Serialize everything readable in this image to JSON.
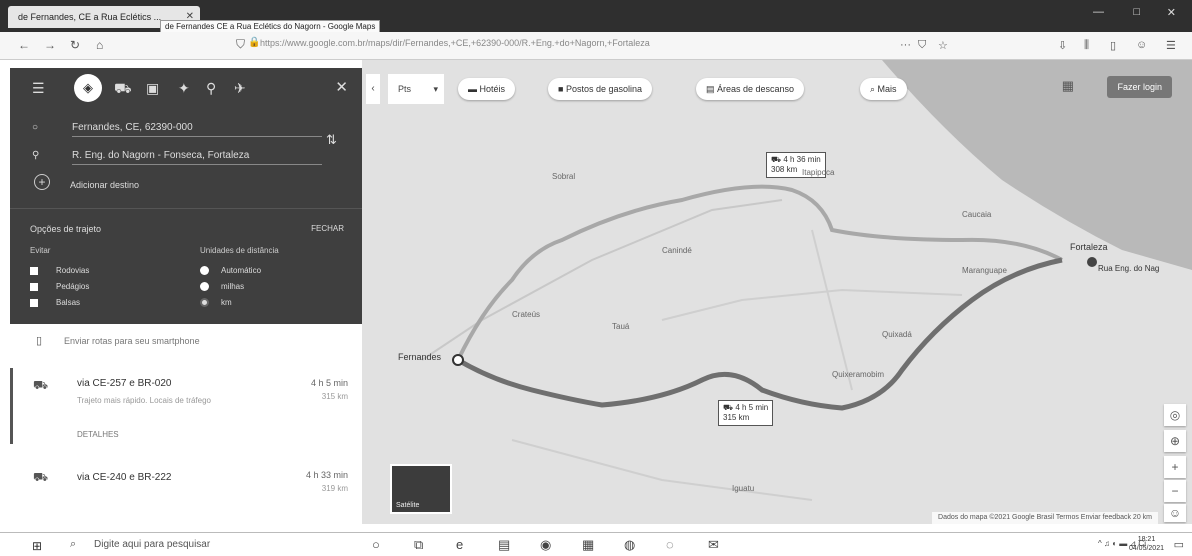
{
  "browser": {
    "tab_title": "de Fernandes, CE a Rua Eclétics ...",
    "tab_tooltip": "de Fernandes CE a Rua Eclétics do Nagorn - Google Maps",
    "url": "https://www.google.com.br/maps/dir/Fernandes,+CE,+62390-000/R.+Eng.+do+Nagorn,+Fortaleza",
    "window_controls": [
      "—",
      "□",
      "✕"
    ]
  },
  "sidebar": {
    "origin": "Fernandes, CE, 62390-000",
    "destination": "R. Eng. do Nagorn - Fonseca, Fortaleza",
    "add_destination": "Adicionar destino",
    "options_title": "Opções de trajeto",
    "options_close": "FECHAR",
    "avoid_heading": "Evitar",
    "avoid_options": [
      "Rodovias",
      "Pedágios",
      "Balsas"
    ],
    "units_heading": "Unidades de distância",
    "unit_options": [
      "Automático",
      "milhas",
      "km"
    ],
    "selected_unit": "km"
  },
  "routes": {
    "note": "Enviar rotas para seu smartphone",
    "items": [
      {
        "title": "via CE-257 e BR-020",
        "time": "4 h 5 min",
        "distance": "315 km",
        "sub": "Trajeto mais rápido. Locais de tráfego",
        "details": "DETALHES"
      },
      {
        "title": "via CE-240 e BR-222",
        "time": "4 h 33 min",
        "distance": "319 km",
        "sub": "",
        "details": ""
      }
    ]
  },
  "map": {
    "vehicle": "Pts",
    "chips": [
      "Hotéis",
      "Postos de gasolina",
      "Áreas de descanso",
      "Mais"
    ],
    "signin": "Fazer login",
    "origin_label": "Fernandes",
    "dest_label": "Fortaleza",
    "dest_pin_label": "Rua Eng. do Nag",
    "callout_a_time": "4 h 36 min",
    "callout_a_dist": "308 km",
    "callout_b_time": "4 h 5 min",
    "callout_b_dist": "315 km",
    "places": [
      "Sobral",
      "Canindé",
      "Quixadá",
      "Itapipoca",
      "Caucaia",
      "Maranguape",
      "Quixeramobim",
      "Crateús",
      "Tauá",
      "Iguatu"
    ],
    "layers_label": "Satélite",
    "footer": "Dados do mapa ©2021 Google   Brasil   Termos   Enviar feedback   20 km"
  },
  "taskbar": {
    "search_placeholder": "Digite aqui para pesquisar",
    "tray": "^ ♫ ◐ ▬ ⊿ Ci",
    "time": "18:21",
    "date": "04/05/2021"
  }
}
